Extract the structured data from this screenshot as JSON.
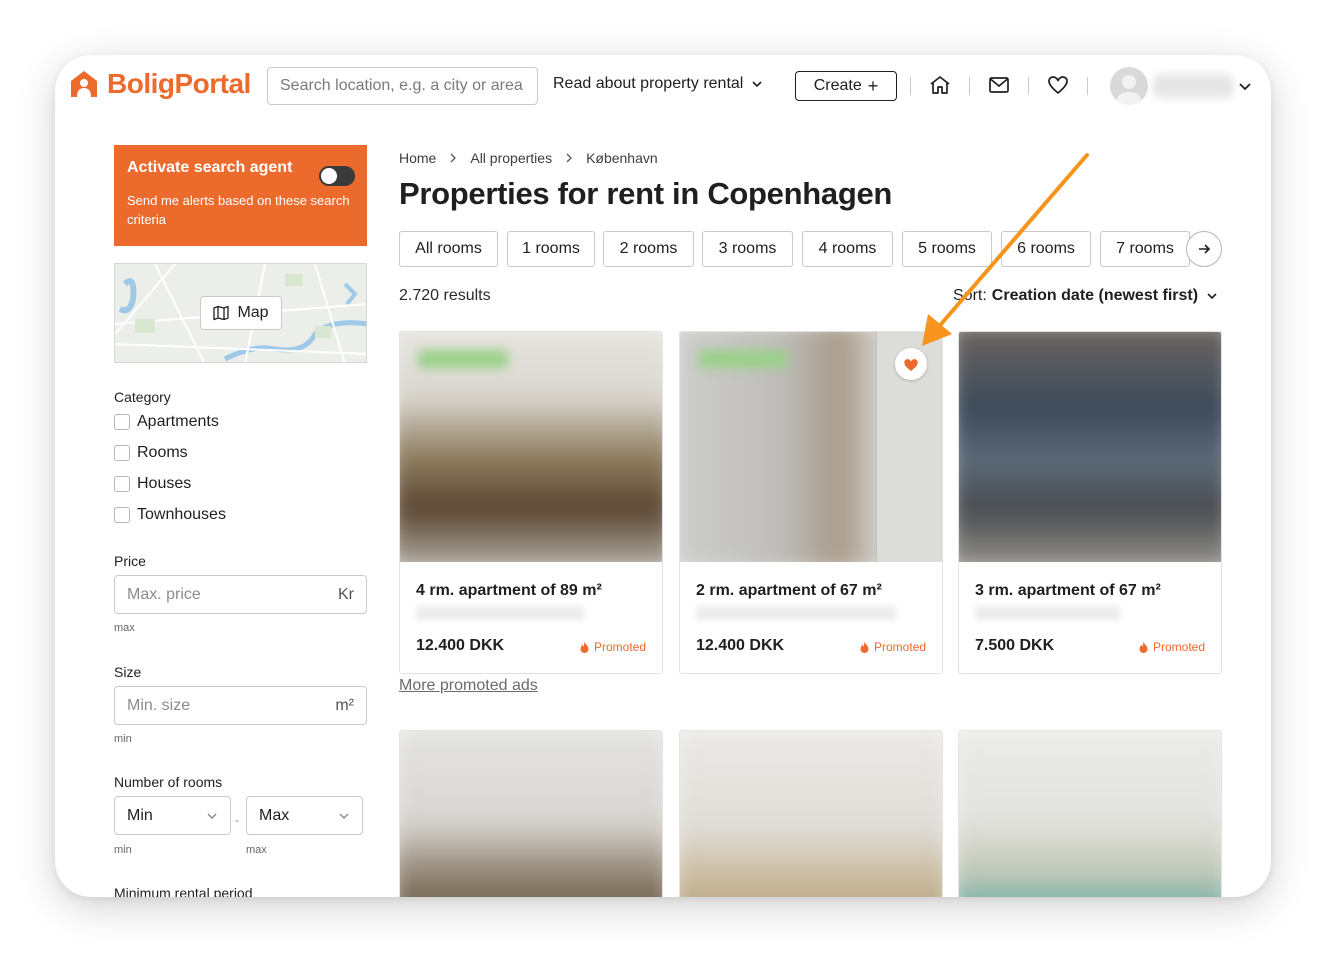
{
  "brand": {
    "name": "BoligPortal",
    "color": "#ec6a2c"
  },
  "header": {
    "search_placeholder": "Search location, e.g. a city or area",
    "read_about": "Read about property rental",
    "create": "Create",
    "create_icon": "+",
    "icons": [
      "home-icon",
      "mail-icon",
      "heart-icon"
    ]
  },
  "sidebar": {
    "agent": {
      "title": "Activate search agent",
      "subtitle": "Send me alerts based on these search criteria"
    },
    "map_button": "Map",
    "category_label": "Category",
    "categories": [
      "Apartments",
      "Rooms",
      "Houses",
      "Townhouses"
    ],
    "price_label": "Price",
    "price_placeholder": "Max. price",
    "price_unit": "Kr",
    "price_hint": "max",
    "size_label": "Size",
    "size_placeholder": "Min. size",
    "size_unit": "m²",
    "size_hint": "min",
    "rooms_label": "Number of rooms",
    "rooms_min": "Min",
    "rooms_max": "Max",
    "rooms_min_hint": "min",
    "rooms_max_hint": "max",
    "rental_period_label": "Minimum rental period"
  },
  "main": {
    "breadcrumb": [
      "Home",
      "All properties",
      "København"
    ],
    "title": "Properties for rent in Copenhagen",
    "room_filters": [
      "All rooms",
      "1 rooms",
      "2 rooms",
      "3 rooms",
      "4 rooms",
      "5 rooms",
      "6 rooms",
      "7 rooms"
    ],
    "results": "2.720 results",
    "sort_label": "Sort:",
    "sort_value": "Creation date (newest first)",
    "cards": [
      {
        "title": "4 rm. apartment of 89 m²",
        "price": "12.400 DKK",
        "badge": "Promoted"
      },
      {
        "title": "2 rm. apartment of 67 m²",
        "price": "12.400 DKK",
        "badge": "Promoted",
        "favorited": true
      },
      {
        "title": "3 rm. apartment of 67 m²",
        "price": "7.500 DKK",
        "badge": "Promoted"
      }
    ],
    "more_promoted": "More promoted ads"
  },
  "annotation": {
    "arrow_color": "#f7941d"
  }
}
